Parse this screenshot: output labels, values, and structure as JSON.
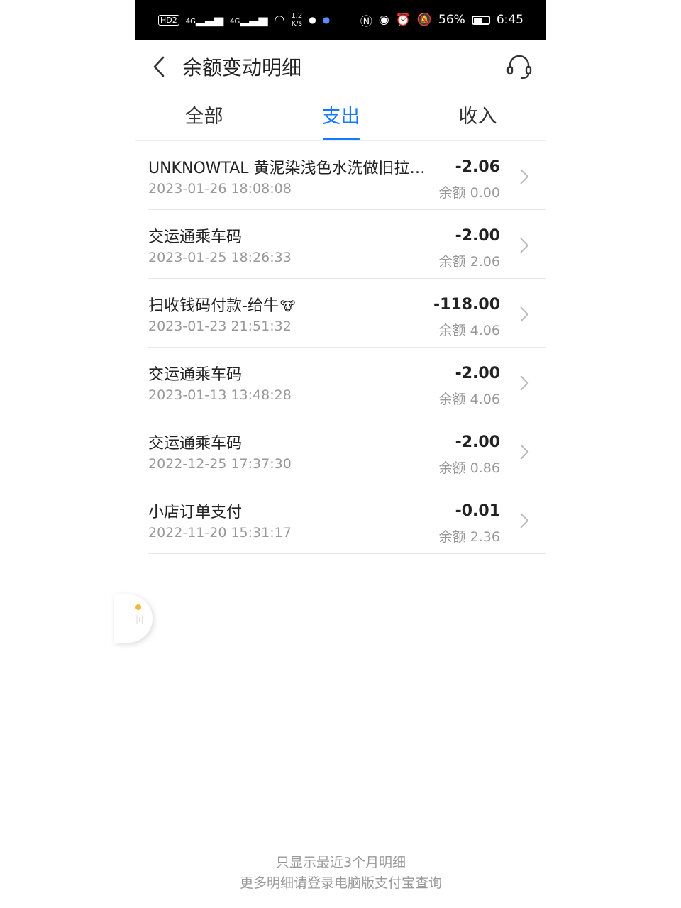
{
  "status_bar": {
    "hd": "HD",
    "sim": "2",
    "net1": "4G",
    "net2": "4G",
    "speed_top": "1.2",
    "speed_bottom": "K/s",
    "battery": "56%",
    "time": "6:45"
  },
  "header": {
    "title": "余额变动明细",
    "back_icon": "chevron-left-icon",
    "service_icon": "headset-icon"
  },
  "tabs": [
    {
      "label": "全部",
      "active": false
    },
    {
      "label": "支出",
      "active": true
    },
    {
      "label": "收入",
      "active": false
    }
  ],
  "accent_color": "#1677ff",
  "transactions": [
    {
      "name": "UNKNOWTAL 黄泥染浅色水洗做旧拉链开衫卫衣",
      "time": "2023-01-26 18:08:08",
      "amount": "-2.06",
      "balance": "余额 0.00"
    },
    {
      "name": "交运通乘车码",
      "time": "2023-01-25 18:26:33",
      "amount": "-2.00",
      "balance": "余额 2.06"
    },
    {
      "name": "扫收钱码付款-给牛",
      "time": "2023-01-23 21:51:32",
      "amount": "-118.00",
      "balance": "余额 4.06"
    },
    {
      "name": "交运通乘车码",
      "time": "2023-01-13 13:48:28",
      "amount": "-2.00",
      "balance": "余额 4.06"
    },
    {
      "name": "交运通乘车码",
      "time": "2022-12-25 17:37:30",
      "amount": "-2.00",
      "balance": "余额 0.86"
    },
    {
      "name": "小店订单支付",
      "time": "2022-11-20 15:31:17",
      "amount": "-0.01",
      "balance": "余额 2.36"
    }
  ],
  "footer": {
    "line1": "只显示最近3个月明细",
    "line2": "更多明细请登录电脑版支付宝查询"
  }
}
